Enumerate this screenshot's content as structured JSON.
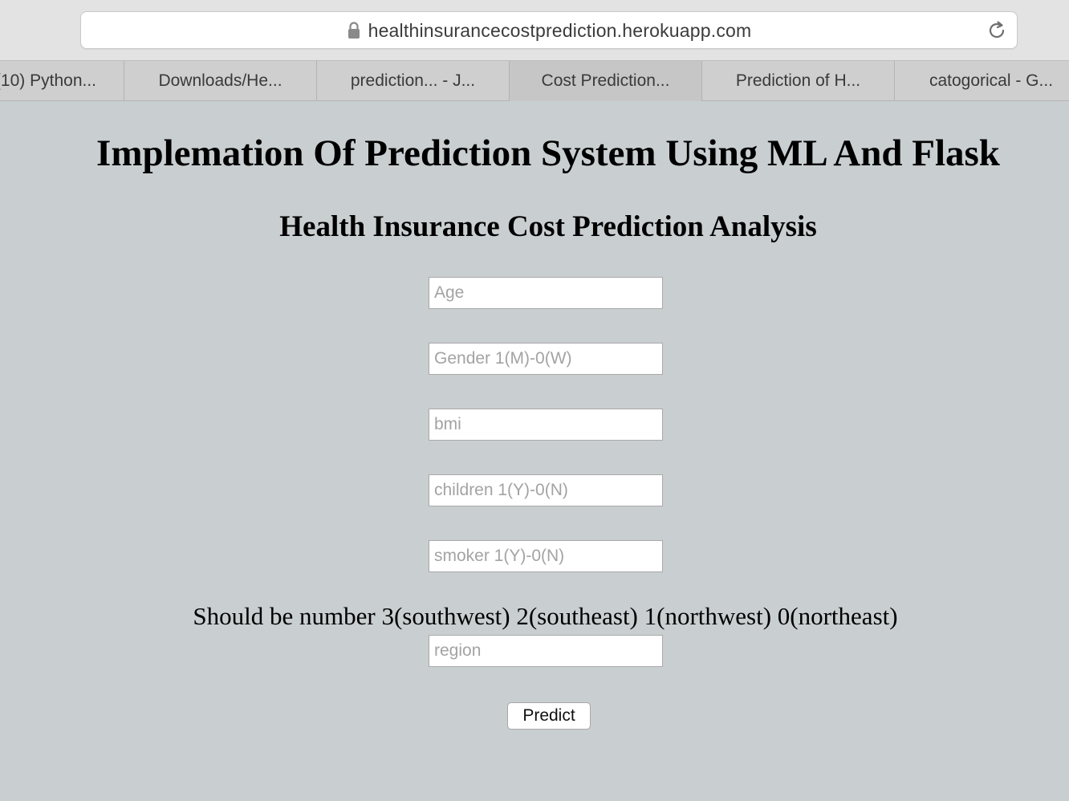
{
  "browser": {
    "url": "healthinsurancecostprediction.herokuapp.com",
    "tabs": [
      {
        "label": "(10) Python..."
      },
      {
        "label": "Downloads/He..."
      },
      {
        "label": "prediction... - J..."
      },
      {
        "label": "Cost Prediction..."
      },
      {
        "label": "Prediction of H..."
      },
      {
        "label": "catogorical - G..."
      }
    ]
  },
  "page": {
    "title": "Implemation Of Prediction System Using ML And Flask",
    "subtitle": "Health Insurance Cost Prediction Analysis",
    "fields": {
      "age": {
        "placeholder": "Age",
        "value": ""
      },
      "gender": {
        "placeholder": "Gender 1(M)-0(W)",
        "value": ""
      },
      "bmi": {
        "placeholder": "bmi",
        "value": ""
      },
      "children": {
        "placeholder": "children 1(Y)-0(N)",
        "value": ""
      },
      "smoker": {
        "placeholder": "smoker 1(Y)-0(N)",
        "value": ""
      },
      "region": {
        "placeholder": "region",
        "value": ""
      }
    },
    "region_note": "Should be number 3(southwest) 2(southeast) 1(northwest) 0(northeast)",
    "predict_label": "Predict"
  },
  "colors": {
    "page_background": "#c9ced1",
    "tabbar_background": "#cfcfcf"
  }
}
